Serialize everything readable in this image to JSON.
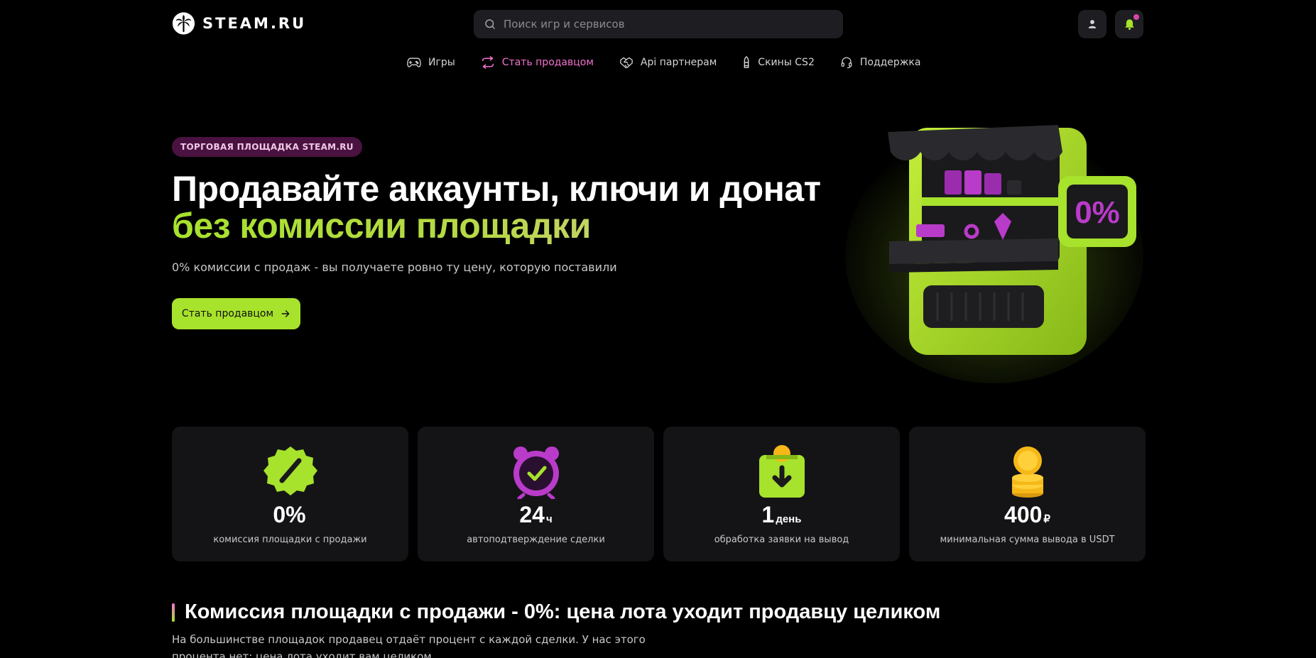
{
  "header": {
    "brand": "STEAM.RU",
    "search_placeholder": "Поиск игр и сервисов",
    "icons": {
      "search": "search-icon",
      "user": "user-icon",
      "bell": "bell-icon"
    },
    "bell_has_notification": true
  },
  "nav": {
    "items": [
      {
        "label": "Игры",
        "icon": "gamepad-icon",
        "active": false
      },
      {
        "label": "Стать продавцом",
        "icon": "exchange-icon",
        "active": true
      },
      {
        "label": "Api партнерам",
        "icon": "handshake-icon",
        "active": false
      },
      {
        "label": "Скины CS2",
        "icon": "bullet-icon",
        "active": false
      },
      {
        "label": "Поддержка",
        "icon": "headset-icon",
        "active": false
      }
    ]
  },
  "hero": {
    "badge": "ТОРГОВАЯ ПЛОЩАДКА STEAM.RU",
    "title_line1": "Продавайте аккаунты, ключи и донат",
    "title_line2": "без комиссии площадки",
    "subtitle": "0% комиссии с продаж - вы получаете ровно ту цену, которую поставили",
    "cta_label": "Стать продавцом",
    "art_sign": "0%"
  },
  "stats": [
    {
      "value": "0%",
      "unit": "",
      "label": "комиссия площадки с продажи",
      "icon": "percent-badge-icon"
    },
    {
      "value": "24",
      "unit": "ч",
      "label": "автоподтверждение сделки",
      "icon": "alarm-clock-icon"
    },
    {
      "value": "1",
      "unit": "день",
      "label": "обработка заявки на вывод",
      "icon": "withdraw-box-icon"
    },
    {
      "value": "400",
      "unit": "₽",
      "label": "минимальная сумма вывода в USDT",
      "icon": "coins-stack-icon"
    }
  ],
  "section": {
    "title": "Комиссия площадки с продажи - 0%: цена лота уходит продавцу целиком",
    "text": "На большинстве площадок продавец отдаёт процент с каждой сделки. У нас этого процента нет: цена лота уходит вам целиком"
  },
  "colors": {
    "accent_green": "#a7e22c",
    "accent_pink": "#f472d0",
    "card_bg": "#141417",
    "badge_bg": "#4a1240"
  }
}
